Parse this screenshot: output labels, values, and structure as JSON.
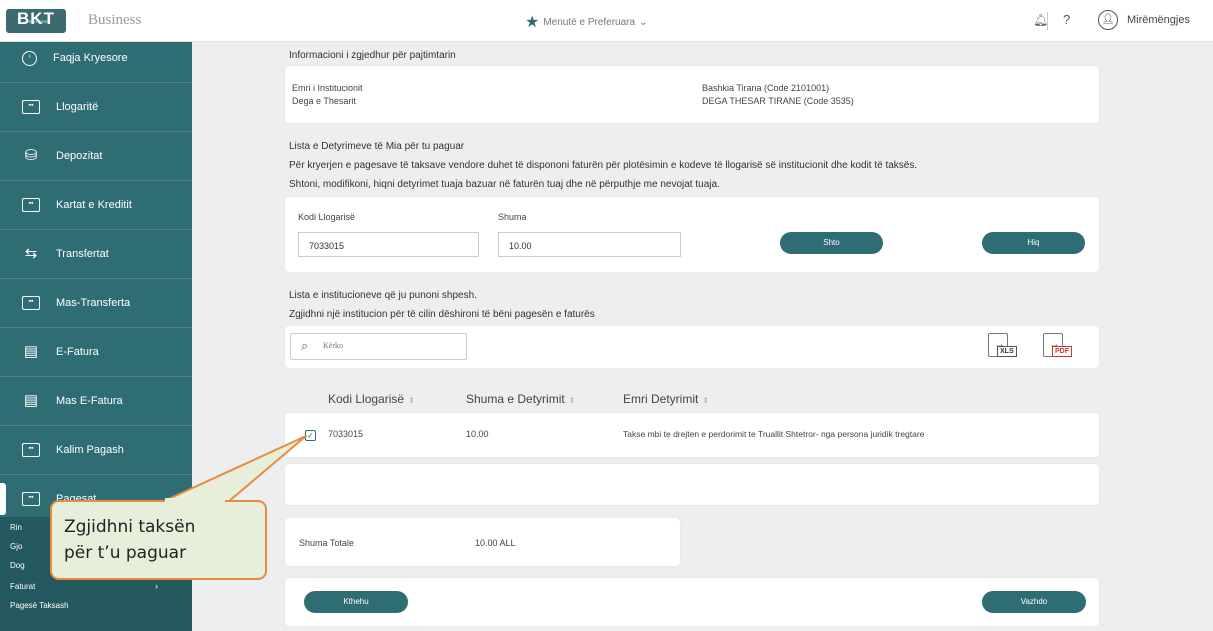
{
  "topbar": {
    "logo": "BKT",
    "logo_sub": "BANKA KOMBËTARE TREGTARE",
    "brand": "Business",
    "favorites": "Menutë e Preferuara",
    "help": "?",
    "greeting": "Mirëmëngjes"
  },
  "sidebar": {
    "items": [
      {
        "label": "Faqja Kryesore",
        "icon": "home-icon"
      },
      {
        "label": "Llogaritë",
        "icon": "account-card-icon"
      },
      {
        "label": "Depozitat",
        "icon": "deposit-icon"
      },
      {
        "label": "Kartat e Kreditit",
        "icon": "credit-card-icon"
      },
      {
        "label": "Transfertat",
        "icon": "transfer-icon"
      },
      {
        "label": "Mas-Transferta",
        "icon": "mass-transfer-icon"
      },
      {
        "label": "E-Fatura",
        "icon": "invoice-icon"
      },
      {
        "label": "Mas E-Fatura",
        "icon": "mass-invoice-icon"
      },
      {
        "label": "Kalim Pagash",
        "icon": "salary-icon"
      },
      {
        "label": "Pagesat",
        "icon": "payments-icon"
      }
    ],
    "sub": {
      "item1": "Rin",
      "item2": "Gjo",
      "item3": "Dog",
      "faturat": "Faturat",
      "pagese_taksash": "Pagesë Taksash"
    }
  },
  "info": {
    "title": "Informacioni i zgjedhur për pajtimtarin",
    "inst_label": "Emri i Institucionit",
    "branch_label": "Dega e Thesarit",
    "inst_value": "Bashkia Tirana (Code 2101001)",
    "branch_value": "DEGA THESAR TIRANE (Code 3535)"
  },
  "obligations": {
    "title": "Lista e Detyrimeve të Mia për tu paguar",
    "line1": "Për kryerjen e pagesave të taksave vendore duhet të dispononi faturën për plotësimin e kodeve të llogarisë së institucionit dhe kodit të taksës.",
    "line2": "Shtoni, modifikoni, hiqni detyrimet tuaja bazuar në faturën tuaj dhe në përputhje me nevojat tuaja.",
    "account_label": "Kodi Llogarisë",
    "amount_label": "Shuma",
    "account_value": "7033015",
    "amount_value": "10.00",
    "add_button": "Shto",
    "remove_button": "Hiq"
  },
  "institutions": {
    "title": "Lista e institucioneve që ju punoni shpesh.",
    "subtitle": "Zgjidhni një institucion për të cilin dëshironi të bëni pagesën e faturës",
    "search_placeholder": "Kërko",
    "xls": "XLS",
    "pdf": "PDF"
  },
  "table": {
    "columns": [
      "Kodi Llogarisë",
      "Shuma e Detyrimit",
      "Emri Detyrimit"
    ],
    "rows": [
      {
        "account": "7033015",
        "amount": "10.00",
        "name": "Takse mbi te drejten e perdorimit te Truallit Shtetror- nga persona juridik tregtare",
        "checked": true
      }
    ]
  },
  "total": {
    "label": "Shuma Totale",
    "value": "10.00 ALL"
  },
  "footer": {
    "back": "Kthehu",
    "next": "Vazhdo"
  },
  "callout": {
    "line1": "Zgjidhni taksën",
    "line2": "për t’u paguar",
    "border_color": "#ea8a3c",
    "fill_color": "#e7efda"
  },
  "colors": {
    "accent": "#2f6d75"
  }
}
